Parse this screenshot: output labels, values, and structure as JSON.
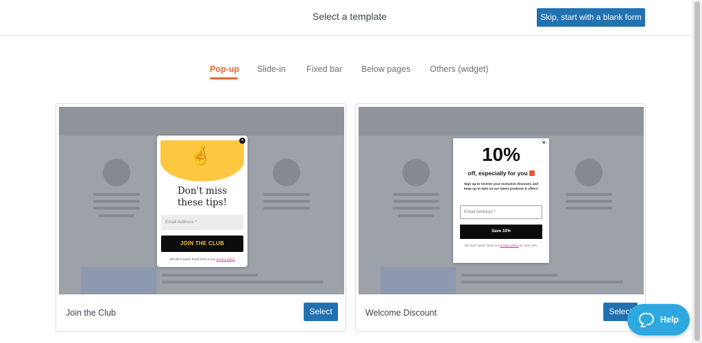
{
  "header": {
    "title": "Select a template",
    "skip_button": "Skip, start with a blank form"
  },
  "tabs": [
    {
      "label": "Pop-up",
      "active": true
    },
    {
      "label": "Slide-in",
      "active": false
    },
    {
      "label": "Fixed bar",
      "active": false
    },
    {
      "label": "Below pages",
      "active": false
    },
    {
      "label": "Others (widget)",
      "active": false
    }
  ],
  "templates": [
    {
      "name": "Join the Club",
      "select_label": "Select",
      "popup": {
        "title_line1": "Don't miss",
        "title_line2": "these tips!",
        "email_placeholder": "Email Address *",
        "button": "JOIN THE CLUB",
        "note_prefix": "We don't spam! Read more in our ",
        "note_link": "privacy policy"
      }
    },
    {
      "name": "Welcome Discount",
      "select_label": "Select",
      "popup": {
        "headline": "10%",
        "subheadline": "off, especially for you",
        "description": "Sign up to receive your exclusive discount, and keep up to date on our latest products & offers!",
        "email_placeholder": "Email Address *",
        "button": "Save 10%",
        "note_prefix": "We don't spam! Read our ",
        "note_link": "privacy policy",
        "note_suffix": " for more info."
      }
    }
  ],
  "help": {
    "label": "Help"
  },
  "colors": {
    "accent": "#e9682e",
    "primary": "#2271b1",
    "help": "#2fa8e0",
    "popup_yellow": "#fdc740"
  }
}
